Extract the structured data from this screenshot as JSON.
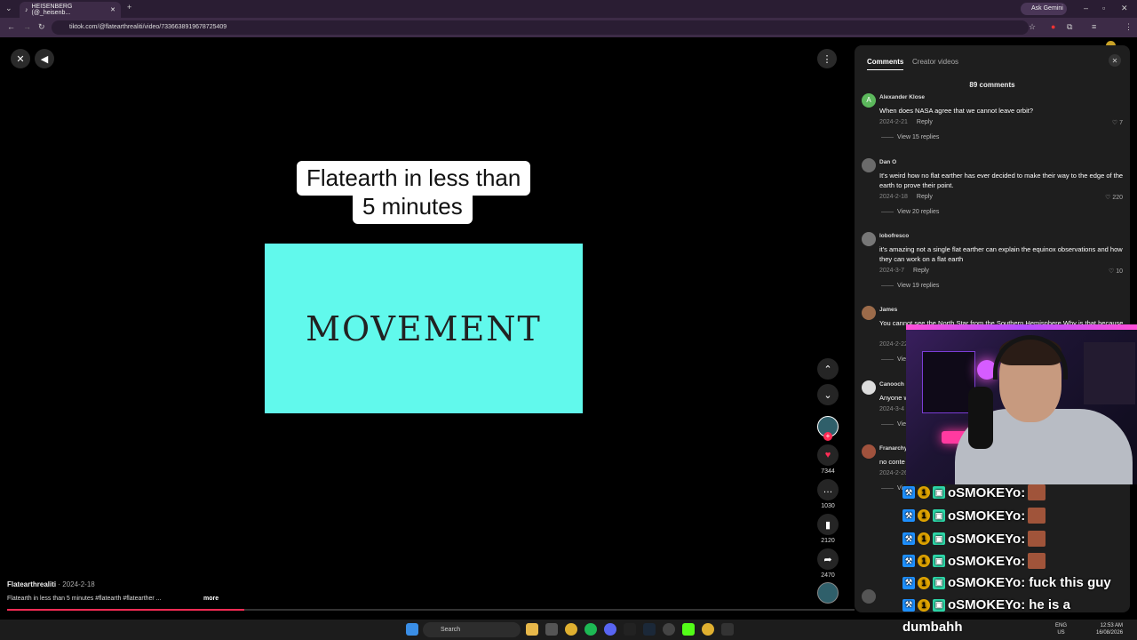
{
  "browser": {
    "tab_title": "HEISENBERG (@_heisenb...",
    "url": "tiktok.com/@flatearthrealiti/video/7336638919678725409",
    "ask_gemini": "Ask Gemini",
    "new_tab_symbol": "+"
  },
  "video": {
    "caption_line1": "Flatearth in less than",
    "caption_line2": "5 minutes",
    "slide_text": "MOVEMENT",
    "author": "Flatearthrealiti",
    "date": "2024-2-18",
    "description": "Flatearth in less than 5 minutes #flatearth #flatearther ...",
    "more": "more",
    "progress_fraction": 0.28,
    "likes": "7344",
    "comments": "1030",
    "saves": "2120",
    "shares": "2470"
  },
  "panel": {
    "tab_comments": "Comments",
    "tab_creator": "Creator videos",
    "count": "89 comments",
    "reply_label": "Reply",
    "comments": [
      {
        "name": "Alexander Klose",
        "text": "When does NASA agree that we cannot leave orbit?",
        "date": "2024-2-21",
        "likes": "7",
        "replies": "View 15 replies",
        "avatar_color": "#5cb85c",
        "avatar_letter": "A"
      },
      {
        "name": "Dan O",
        "text": "It's weird how no flat earther has ever decided to make their way to the edge of the earth to prove their point.",
        "date": "2024-2-18",
        "likes": "220",
        "replies": "View 20 replies",
        "avatar_color": "#6b6b6b",
        "avatar_letter": ""
      },
      {
        "name": "lobofresco",
        "text": "it's amazing not a single flat earther can explain the equinox observations and how they can work on a flat earth",
        "date": "2024-3-7",
        "likes": "10",
        "replies": "View 19 replies",
        "avatar_color": "#777",
        "avatar_letter": ""
      },
      {
        "name": "James",
        "text": "You cannot see the North Star from the Southern Hemisphere Why is that because",
        "date": "2024-2-22",
        "likes": "",
        "replies": "View",
        "avatar_color": "#9c6b4a",
        "avatar_letter": ""
      },
      {
        "name": "Canooch",
        "text": "Anyone w",
        "date": "2024-3-4",
        "likes": "",
        "replies": "View",
        "avatar_color": "#ddd",
        "avatar_letter": ""
      },
      {
        "name": "Franarchy",
        "text": "no conte",
        "date": "2024-2-26",
        "likes": "",
        "replies": "View",
        "avatar_color": "#a0523d",
        "avatar_letter": ""
      }
    ]
  },
  "chat": {
    "lines": [
      {
        "user": "oSMOKEYo:",
        "msg": "",
        "emote": true
      },
      {
        "user": "oSMOKEYo:",
        "msg": "",
        "emote": true
      },
      {
        "user": "oSMOKEYo:",
        "msg": "",
        "emote": true
      },
      {
        "user": "oSMOKEYo:",
        "msg": "",
        "emote": true
      },
      {
        "user": "oSMOKEYo:",
        "msg": "fuck this guy",
        "emote": false
      },
      {
        "user": "oSMOKEYo:",
        "msg": "he is a",
        "emote": false
      }
    ],
    "wrap": "dumbahh"
  },
  "taskbar": {
    "search": "Search",
    "lang1": "ENG",
    "lang2": "US",
    "time": "12:53 AM",
    "date": "16/08/2026"
  }
}
